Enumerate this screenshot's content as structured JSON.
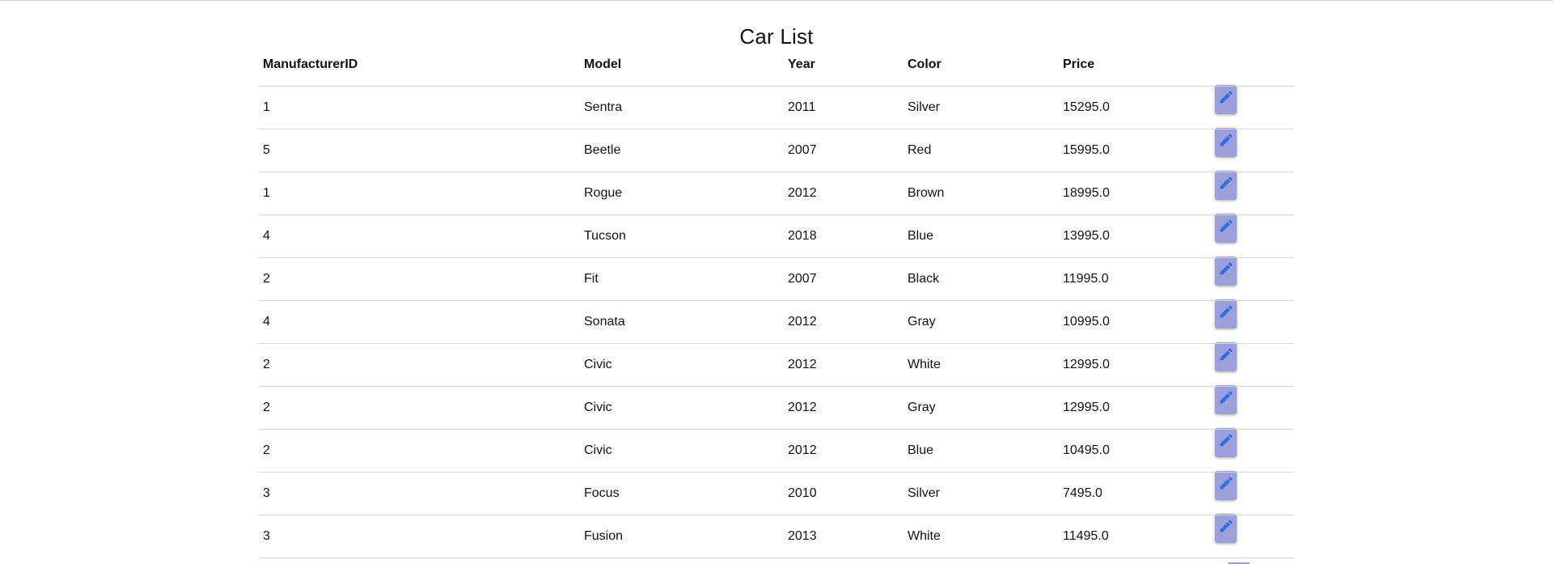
{
  "page": {
    "title": "Car List"
  },
  "table": {
    "headers": [
      "ManufacturerID",
      "Model",
      "Year",
      "Color",
      "Price",
      ""
    ],
    "rows": [
      {
        "manufacturer_id": "1",
        "model": "Sentra",
        "year": "2011",
        "color": "Silver",
        "price": "15295.0"
      },
      {
        "manufacturer_id": "5",
        "model": "Beetle",
        "year": "2007",
        "color": "Red",
        "price": "15995.0"
      },
      {
        "manufacturer_id": "1",
        "model": "Rogue",
        "year": "2012",
        "color": "Brown",
        "price": "18995.0"
      },
      {
        "manufacturer_id": "4",
        "model": "Tucson",
        "year": "2018",
        "color": "Blue",
        "price": "13995.0"
      },
      {
        "manufacturer_id": "2",
        "model": "Fit",
        "year": "2007",
        "color": "Black",
        "price": "11995.0"
      },
      {
        "manufacturer_id": "4",
        "model": "Sonata",
        "year": "2012",
        "color": "Gray",
        "price": "10995.0"
      },
      {
        "manufacturer_id": "2",
        "model": "Civic",
        "year": "2012",
        "color": "White",
        "price": "12995.0"
      },
      {
        "manufacturer_id": "2",
        "model": "Civic",
        "year": "2012",
        "color": "Gray",
        "price": "12995.0"
      },
      {
        "manufacturer_id": "2",
        "model": "Civic",
        "year": "2012",
        "color": "Blue",
        "price": "10495.0"
      },
      {
        "manufacturer_id": "3",
        "model": "Focus",
        "year": "2010",
        "color": "Silver",
        "price": "7495.0"
      },
      {
        "manufacturer_id": "3",
        "model": "Fusion",
        "year": "2013",
        "color": "White",
        "price": "11495.0"
      }
    ],
    "row_action_icon": "pencil-icon"
  },
  "colors": {
    "edit_button_bg": "#9ba0db",
    "pencil": "#2f6fe0",
    "divider": "#d6d6d6"
  }
}
